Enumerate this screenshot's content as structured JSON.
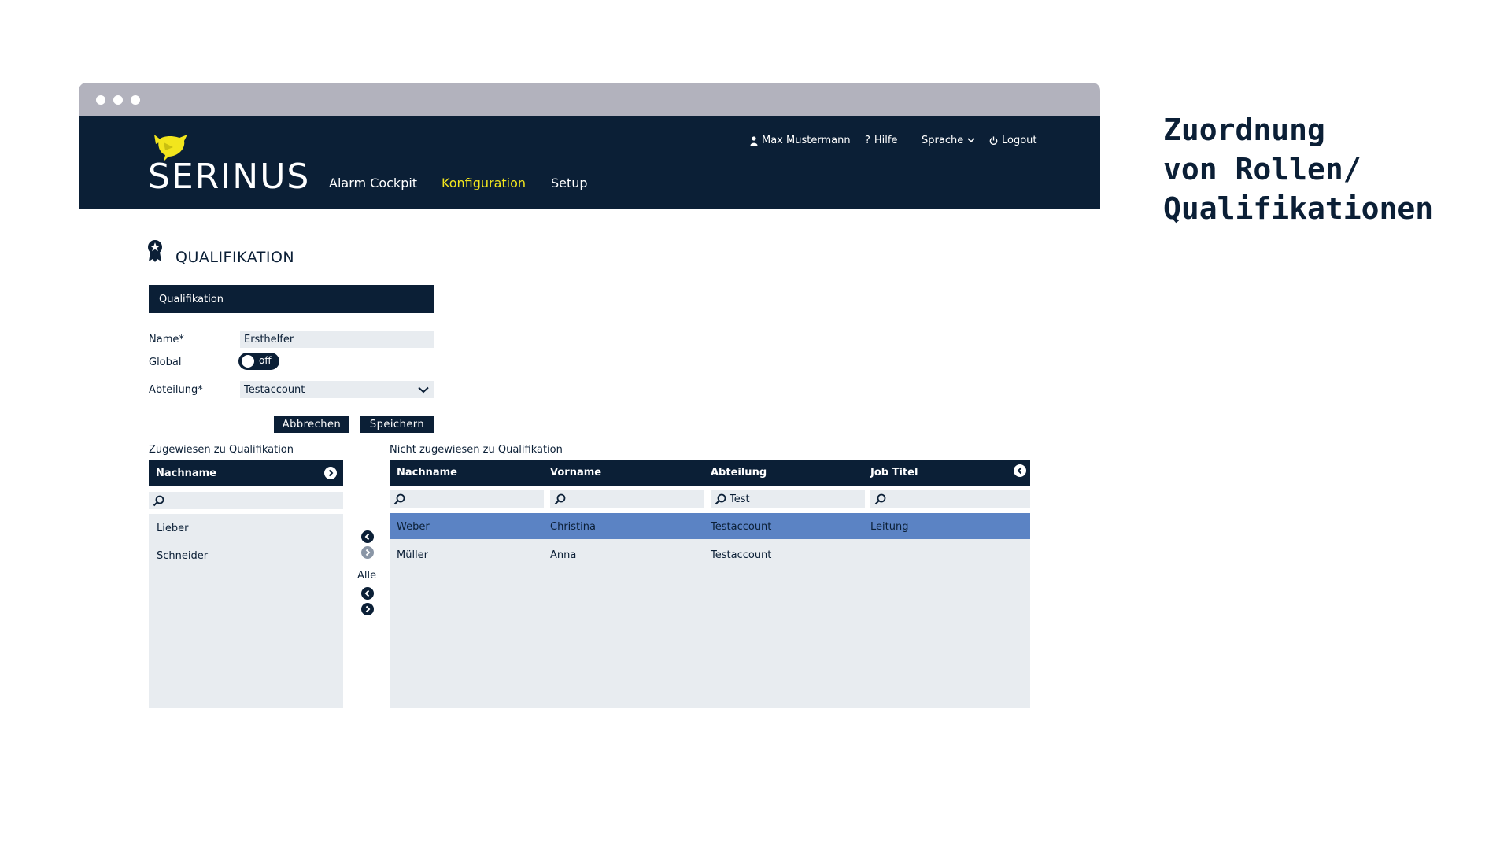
{
  "side_title": {
    "line1": "Zuordnung",
    "line2": "von Rollen/",
    "line3": "Qualifikationen"
  },
  "header": {
    "logo_text": "SERINUS",
    "nav": [
      {
        "label": "Alarm Cockpit",
        "active": false
      },
      {
        "label": "Konfiguration",
        "active": true
      },
      {
        "label": "Setup",
        "active": false
      }
    ],
    "user_name": "Max Mustermann",
    "help_label": "Hilfe",
    "language_label": "Sprache",
    "logout_label": "Logout"
  },
  "page": {
    "title": "QUALIFIKATION"
  },
  "form": {
    "panel_title": "Qualifikation",
    "name_label": "Name*",
    "name_value": "Ersthelfer",
    "global_label": "Global",
    "global_toggle": "off",
    "department_label": "Abteilung*",
    "department_value": "Testaccount",
    "cancel_label": "Abbrechen",
    "save_label": "Speichern"
  },
  "assigned": {
    "caption": "Zugewiesen zu Qualifikation",
    "column": "Nachname",
    "rows": [
      "Lieber",
      "Schneider"
    ]
  },
  "transfer": {
    "all_label": "Alle"
  },
  "unassigned": {
    "caption": "Nicht zugewiesen zu Qualifikation",
    "columns": [
      "Nachname",
      "Vorname",
      "Abteilung",
      "Job Titel"
    ],
    "filters": [
      "",
      "",
      "Test",
      ""
    ],
    "rows": [
      {
        "nachname": "Weber",
        "vorname": "Christina",
        "abteilung": "Testaccount",
        "job_titel": "Leitung",
        "selected": true
      },
      {
        "nachname": "Müller",
        "vorname": "Anna",
        "abteilung": "Testaccount",
        "job_titel": "",
        "selected": false
      }
    ]
  },
  "colors": {
    "navy": "#0b1f36",
    "accent_yellow": "#f2e51d",
    "selected_row": "#5b83c4",
    "panel_grey": "#e8ecf0"
  },
  "icons": [
    "bird-logo-icon",
    "user-icon",
    "help-icon",
    "chevron-down-icon",
    "power-icon",
    "award-icon",
    "search-icon",
    "arrow-left-circle-icon",
    "arrow-right-circle-icon"
  ]
}
